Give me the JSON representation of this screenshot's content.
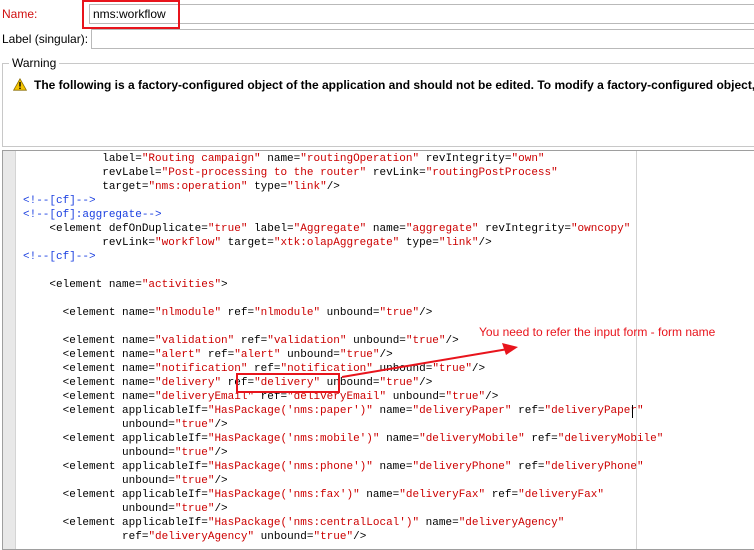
{
  "form": {
    "name_label": "Name:",
    "name_value": "nms:workflow",
    "label_label": "Label (singular):",
    "label_value": ""
  },
  "warning": {
    "legend": "Warning",
    "message": "The following is a factory-configured object of the application and should not be edited. To modify a factory-configured object, you"
  },
  "editor": {
    "lines": [
      [
        {
          "t": "            "
        },
        {
          "t": "label=",
          "c": "a"
        },
        {
          "t": "\"Routing campaign\"",
          "c": "v"
        },
        {
          "t": " name=",
          "c": "a"
        },
        {
          "t": "\"routingOperation\"",
          "c": "v"
        },
        {
          "t": " revIntegrity=",
          "c": "a"
        },
        {
          "t": "\"own\"",
          "c": "v"
        }
      ],
      [
        {
          "t": "            "
        },
        {
          "t": "revLabel=",
          "c": "a"
        },
        {
          "t": "\"Post-processing to the router\"",
          "c": "v"
        },
        {
          "t": " revLink=",
          "c": "a"
        },
        {
          "t": "\"routingPostProcess\"",
          "c": "v"
        }
      ],
      [
        {
          "t": "            "
        },
        {
          "t": "target=",
          "c": "a"
        },
        {
          "t": "\"nms:operation\"",
          "c": "v"
        },
        {
          "t": " type=",
          "c": "a"
        },
        {
          "t": "\"link\"",
          "c": "v"
        },
        {
          "t": "/>",
          "c": "k"
        }
      ],
      [
        {
          "t": "<!--[cf]-->",
          "c": "c"
        }
      ],
      [
        {
          "t": "<!--[of]:aggregate-->",
          "c": "c"
        }
      ],
      [
        {
          "t": "    <element defOnDuplicate=",
          "c": "k"
        },
        {
          "t": "\"true\"",
          "c": "v"
        },
        {
          "t": " label=",
          "c": "a"
        },
        {
          "t": "\"Aggregate\"",
          "c": "v"
        },
        {
          "t": " name=",
          "c": "a"
        },
        {
          "t": "\"aggregate\"",
          "c": "v"
        },
        {
          "t": " revIntegrity=",
          "c": "a"
        },
        {
          "t": "\"owncopy\"",
          "c": "v"
        }
      ],
      [
        {
          "t": "            "
        },
        {
          "t": "revLink=",
          "c": "a"
        },
        {
          "t": "\"workflow\"",
          "c": "v"
        },
        {
          "t": " target=",
          "c": "a"
        },
        {
          "t": "\"xtk:olapAggregate\"",
          "c": "v"
        },
        {
          "t": " type=",
          "c": "a"
        },
        {
          "t": "\"link\"",
          "c": "v"
        },
        {
          "t": "/>",
          "c": "k"
        }
      ],
      [
        {
          "t": "<!--[cf]-->",
          "c": "c"
        }
      ],
      [
        {
          "t": ""
        }
      ],
      [
        {
          "t": "    <element name=",
          "c": "k"
        },
        {
          "t": "\"activities\"",
          "c": "v"
        },
        {
          "t": ">",
          "c": "k"
        }
      ],
      [
        {
          "t": ""
        }
      ],
      [
        {
          "t": "      <element name=",
          "c": "k"
        },
        {
          "t": "\"nlmodule\"",
          "c": "v"
        },
        {
          "t": " ref=",
          "c": "a"
        },
        {
          "t": "\"nlmodule\"",
          "c": "v"
        },
        {
          "t": " unbound=",
          "c": "a"
        },
        {
          "t": "\"true\"",
          "c": "v"
        },
        {
          "t": "/>",
          "c": "k"
        }
      ],
      [
        {
          "t": ""
        }
      ],
      [
        {
          "t": "      <element name=",
          "c": "k"
        },
        {
          "t": "\"validation\"",
          "c": "v"
        },
        {
          "t": " ref=",
          "c": "a"
        },
        {
          "t": "\"validation\"",
          "c": "v"
        },
        {
          "t": " unbound=",
          "c": "a"
        },
        {
          "t": "\"true\"",
          "c": "v"
        },
        {
          "t": "/>",
          "c": "k"
        }
      ],
      [
        {
          "t": "      <element name=",
          "c": "k"
        },
        {
          "t": "\"alert\"",
          "c": "v"
        },
        {
          "t": " ref=",
          "c": "a"
        },
        {
          "t": "\"alert\"",
          "c": "v"
        },
        {
          "t": " unbound=",
          "c": "a"
        },
        {
          "t": "\"true\"",
          "c": "v"
        },
        {
          "t": "/>",
          "c": "k"
        }
      ],
      [
        {
          "t": "      <element name=",
          "c": "k"
        },
        {
          "t": "\"notification\"",
          "c": "v"
        },
        {
          "t": " ref=",
          "c": "a"
        },
        {
          "t": "\"notification\"",
          "c": "v"
        },
        {
          "t": " unbound=",
          "c": "a"
        },
        {
          "t": "\"true\"",
          "c": "v"
        },
        {
          "t": "/>",
          "c": "k"
        }
      ],
      [
        {
          "t": "      <element name=",
          "c": "k"
        },
        {
          "t": "\"delivery\"",
          "c": "v"
        },
        {
          "t": " ref=",
          "c": "a"
        },
        {
          "t": "\"delivery\"",
          "c": "v"
        },
        {
          "t": " unbound=",
          "c": "a"
        },
        {
          "t": "\"true\"",
          "c": "v"
        },
        {
          "t": "/>",
          "c": "k"
        }
      ],
      [
        {
          "t": "      <element name=",
          "c": "k"
        },
        {
          "t": "\"deliveryEmail\"",
          "c": "v"
        },
        {
          "t": " ref=",
          "c": "a"
        },
        {
          "t": "\"deliveryEmail\"",
          "c": "v"
        },
        {
          "t": " unbound=",
          "c": "a"
        },
        {
          "t": "\"true\"",
          "c": "v"
        },
        {
          "t": "/>",
          "c": "k"
        }
      ],
      [
        {
          "t": "      <element applicableIf=",
          "c": "k"
        },
        {
          "t": "\"HasPackage('nms:paper')\"",
          "c": "v"
        },
        {
          "t": " name=",
          "c": "a"
        },
        {
          "t": "\"deliveryPaper\"",
          "c": "v"
        },
        {
          "t": " ref=",
          "c": "a"
        },
        {
          "t": "\"deliveryPaper\"",
          "c": "v"
        }
      ],
      [
        {
          "t": "               "
        },
        {
          "t": "unbound=",
          "c": "a"
        },
        {
          "t": "\"true\"",
          "c": "v"
        },
        {
          "t": "/>",
          "c": "k"
        }
      ],
      [
        {
          "t": "      <element applicableIf=",
          "c": "k"
        },
        {
          "t": "\"HasPackage('nms:mobile')\"",
          "c": "v"
        },
        {
          "t": " name=",
          "c": "a"
        },
        {
          "t": "\"deliveryMobile\"",
          "c": "v"
        },
        {
          "t": " ref=",
          "c": "a"
        },
        {
          "t": "\"deliveryMobile\"",
          "c": "v"
        }
      ],
      [
        {
          "t": "               "
        },
        {
          "t": "unbound=",
          "c": "a"
        },
        {
          "t": "\"true\"",
          "c": "v"
        },
        {
          "t": "/>",
          "c": "k"
        }
      ],
      [
        {
          "t": "      <element applicableIf=",
          "c": "k"
        },
        {
          "t": "\"HasPackage('nms:phone')\"",
          "c": "v"
        },
        {
          "t": " name=",
          "c": "a"
        },
        {
          "t": "\"deliveryPhone\"",
          "c": "v"
        },
        {
          "t": " ref=",
          "c": "a"
        },
        {
          "t": "\"deliveryPhone\"",
          "c": "v"
        }
      ],
      [
        {
          "t": "               "
        },
        {
          "t": "unbound=",
          "c": "a"
        },
        {
          "t": "\"true\"",
          "c": "v"
        },
        {
          "t": "/>",
          "c": "k"
        }
      ],
      [
        {
          "t": "      <element applicableIf=",
          "c": "k"
        },
        {
          "t": "\"HasPackage('nms:fax')\"",
          "c": "v"
        },
        {
          "t": " name=",
          "c": "a"
        },
        {
          "t": "\"deliveryFax\"",
          "c": "v"
        },
        {
          "t": " ref=",
          "c": "a"
        },
        {
          "t": "\"deliveryFax\"",
          "c": "v"
        }
      ],
      [
        {
          "t": "               "
        },
        {
          "t": "unbound=",
          "c": "a"
        },
        {
          "t": "\"true\"",
          "c": "v"
        },
        {
          "t": "/>",
          "c": "k"
        }
      ],
      [
        {
          "t": "      <element applicableIf=",
          "c": "k"
        },
        {
          "t": "\"HasPackage('nms:centralLocal')\"",
          "c": "v"
        },
        {
          "t": " name=",
          "c": "a"
        },
        {
          "t": "\"deliveryAgency\"",
          "c": "v"
        }
      ],
      [
        {
          "t": "               "
        },
        {
          "t": "ref=",
          "c": "a"
        },
        {
          "t": "\"deliveryAgency\"",
          "c": "v"
        },
        {
          "t": " unbound=",
          "c": "a"
        },
        {
          "t": "\"true\"",
          "c": "v"
        },
        {
          "t": "/>",
          "c": "k"
        }
      ]
    ]
  },
  "annotation": {
    "text": "You need to refer the input form - form name"
  },
  "colors": {
    "highlight": "#e8141c",
    "string_value": "#cc0000",
    "comment": "#1a3fe0",
    "warning_icon": "#f5c400"
  },
  "icons": {
    "warning": "warning-triangle-icon"
  }
}
